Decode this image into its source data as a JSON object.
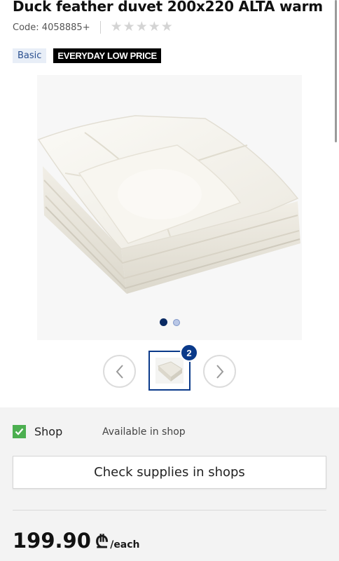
{
  "product": {
    "title": "Duck feather duvet 200x220 ALTA warm",
    "code": "Code: 4058885+",
    "rating_stars": 5,
    "badges": {
      "basic": "Basic",
      "edlp": "EVERYDAY LOW PRICE"
    }
  },
  "gallery": {
    "image_icon": "duvet-photo",
    "dots_total": 2,
    "dots_active_index": 0,
    "thumbnail_count": "2",
    "prev_icon": "chevron-left-icon",
    "next_icon": "chevron-right-icon"
  },
  "availability": {
    "shop_label": "Shop",
    "shop_checked": true,
    "status": "Available in shop",
    "check_button": "Check supplies in shops"
  },
  "price": {
    "amount": "199.90",
    "currency_symbol": "₾",
    "unit": "/each"
  },
  "colors": {
    "accent": "#0a3a8a",
    "check_green": "#4caf50",
    "badge_basic_bg": "#e8eef7"
  }
}
